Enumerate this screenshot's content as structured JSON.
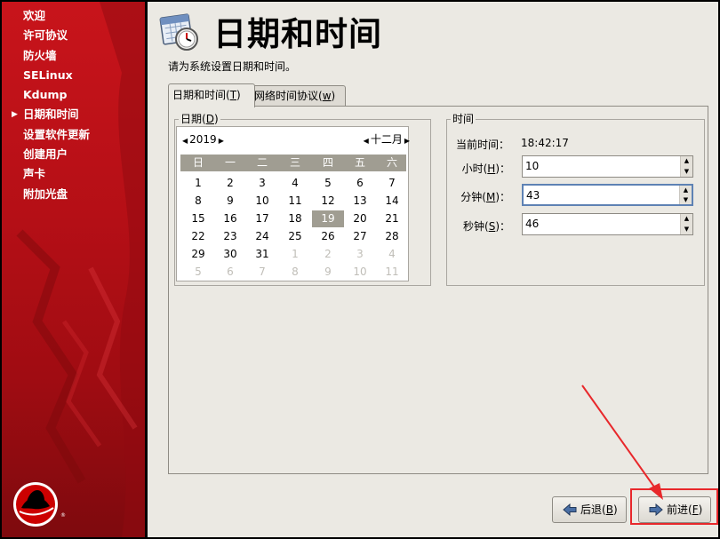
{
  "sidebar": {
    "items": [
      {
        "label": "欢迎",
        "current": false
      },
      {
        "label": "许可协议",
        "current": false
      },
      {
        "label": "防火墙",
        "current": false
      },
      {
        "label": "SELinux",
        "current": false
      },
      {
        "label": "Kdump",
        "current": false
      },
      {
        "label": "日期和时间",
        "current": true
      },
      {
        "label": "设置软件更新",
        "current": false
      },
      {
        "label": "创建用户",
        "current": false
      },
      {
        "label": "声卡",
        "current": false
      },
      {
        "label": "附加光盘",
        "current": false
      }
    ]
  },
  "header": {
    "title": "日期和时间",
    "icon": "calendar-clock-icon"
  },
  "instruction": "请为系统设置日期和时间。",
  "tabs": [
    {
      "label": "日期和时间",
      "mnemonic": "T",
      "active": true
    },
    {
      "label": "网络时间协议",
      "mnemonic": "w",
      "active": false
    }
  ],
  "date": {
    "group_label": "日期",
    "mnemonic": "D",
    "year": "2019",
    "month": "十二月",
    "weekdays": [
      "日",
      "一",
      "二",
      "三",
      "四",
      "五",
      "六"
    ],
    "weeks": [
      [
        "1",
        "2",
        "3",
        "4",
        "5",
        "6",
        "7"
      ],
      [
        "8",
        "9",
        "10",
        "11",
        "12",
        "13",
        "14"
      ],
      [
        "15",
        "16",
        "17",
        "18",
        "19",
        "20",
        "21"
      ],
      [
        "22",
        "23",
        "24",
        "25",
        "26",
        "27",
        "28"
      ],
      [
        "29",
        "30",
        "31",
        "1",
        "2",
        "3",
        "4"
      ],
      [
        "5",
        "6",
        "7",
        "8",
        "9",
        "10",
        "11"
      ]
    ],
    "selected_day": "19"
  },
  "time": {
    "group_label": "时间",
    "current_time_label": "当前时间：",
    "current_time_value": "18:42:17",
    "hour_label": "小时",
    "hour_mnemonic": "H",
    "hour": "10",
    "minute_label": "分钟",
    "minute_mnemonic": "M",
    "minute": "43",
    "second_label": "秒钟",
    "second_mnemonic": "S",
    "second": "46"
  },
  "buttons": {
    "back_label": "后退",
    "back_mnemonic": "B",
    "next_label": "前进",
    "next_mnemonic": "F"
  },
  "colors": {
    "sidebar_red": "#b50f16",
    "highlight": "#e8282b",
    "calendar_header": "#a09d92"
  }
}
